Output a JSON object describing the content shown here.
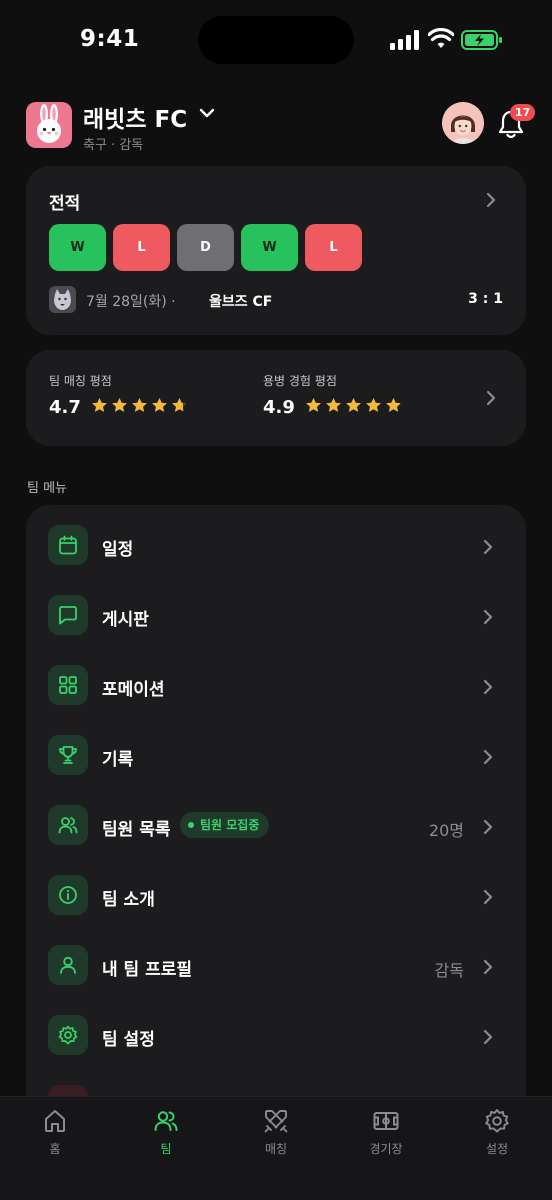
{
  "status_bar": {
    "time": "9:41"
  },
  "header": {
    "team_name": "래빗츠 FC",
    "team_sub": "축구 · 감독",
    "notification_count": "17"
  },
  "record": {
    "title": "전적",
    "results": [
      "W",
      "L",
      "D",
      "W",
      "L"
    ],
    "last_match": {
      "date": "7월 28일(화) ·",
      "opponent": "울브즈 CF",
      "score": "3 : 1"
    }
  },
  "ratings": {
    "team": {
      "label": "팀 매칭 평점",
      "value": "4.7",
      "stars": 4.7
    },
    "mercenary": {
      "label": "용병 경험 평점",
      "value": "4.9",
      "stars": 4.9
    }
  },
  "menu": {
    "section_title": "팀 메뉴",
    "items": [
      {
        "label": "일정",
        "icon": "calendar-icon",
        "value": ""
      },
      {
        "label": "게시판",
        "icon": "message-icon",
        "value": ""
      },
      {
        "label": "포메이션",
        "icon": "grid-icon",
        "value": ""
      },
      {
        "label": "기록",
        "icon": "trophy-icon",
        "value": ""
      },
      {
        "label": "팀원 목록",
        "icon": "users-icon",
        "value": "20명",
        "badge": "팀원 모집중"
      },
      {
        "label": "팀 소개",
        "icon": "info-icon",
        "value": ""
      },
      {
        "label": "내 팀 프로필",
        "icon": "user-icon",
        "value": "감독"
      },
      {
        "label": "팀 설정",
        "icon": "gear-icon",
        "value": ""
      }
    ]
  },
  "tabbar": {
    "tabs": [
      {
        "label": "홈",
        "icon": "home-icon",
        "active": false
      },
      {
        "label": "팀",
        "icon": "team-icon",
        "active": true
      },
      {
        "label": "매칭",
        "icon": "swords-icon",
        "active": false
      },
      {
        "label": "경기장",
        "icon": "field-icon",
        "active": false
      },
      {
        "label": "설정",
        "icon": "gear-icon",
        "active": false
      }
    ]
  },
  "colors": {
    "accent": "#3ad16c",
    "win": "#27c25c",
    "loss": "#ee5a5f",
    "draw": "#6e6e73",
    "star": "#f5b93a"
  }
}
